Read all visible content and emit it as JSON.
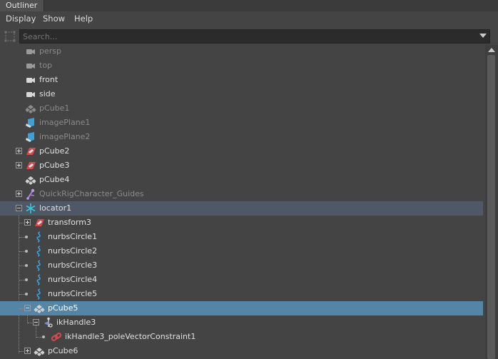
{
  "window": {
    "tab_title": "Outliner"
  },
  "menu": {
    "items": [
      "Display",
      "Show",
      "Help"
    ]
  },
  "search": {
    "placeholder": "Search..."
  },
  "tree": {
    "rows": [
      {
        "label": "persp",
        "icon": "camera-icon",
        "state": "dim"
      },
      {
        "label": "top",
        "icon": "camera-icon",
        "state": "dim"
      },
      {
        "label": "front",
        "icon": "camera-icon",
        "state": "normal"
      },
      {
        "label": "side",
        "icon": "camera-icon",
        "state": "normal"
      },
      {
        "label": "pCube1",
        "icon": "mesh-icon",
        "state": "dim"
      },
      {
        "label": "imagePlane1",
        "icon": "image-plane-icon",
        "state": "dim"
      },
      {
        "label": "imagePlane2",
        "icon": "image-plane-icon",
        "state": "dim"
      },
      {
        "label": "pCube2",
        "icon": "transform-icon",
        "state": "normal",
        "expander": "plus"
      },
      {
        "label": "pCube3",
        "icon": "transform-icon",
        "state": "normal",
        "expander": "plus"
      },
      {
        "label": "pCube4",
        "icon": "mesh-icon",
        "state": "normal"
      },
      {
        "label": "QuickRigCharacter_Guides",
        "icon": "joint-icon",
        "state": "dim",
        "expander": "plus"
      },
      {
        "label": "locator1",
        "icon": "locator-icon",
        "state": "normal",
        "expander": "minus",
        "highlight": true
      },
      {
        "label": "transform3",
        "icon": "transform-icon",
        "state": "normal",
        "expander": "plus"
      },
      {
        "label": "nurbsCircle1",
        "icon": "curve-icon",
        "state": "normal"
      },
      {
        "label": "nurbsCircle2",
        "icon": "curve-icon",
        "state": "normal"
      },
      {
        "label": "nurbsCircle3",
        "icon": "curve-icon",
        "state": "normal"
      },
      {
        "label": "nurbsCircle4",
        "icon": "curve-icon",
        "state": "normal"
      },
      {
        "label": "nurbsCircle5",
        "icon": "curve-icon",
        "state": "normal"
      },
      {
        "label": "pCube5",
        "icon": "mesh-icon",
        "state": "normal",
        "expander": "minus",
        "selected": true
      },
      {
        "label": "ikHandle3",
        "icon": "ik-handle-icon",
        "state": "normal",
        "expander": "minus"
      },
      {
        "label": "ikHandle3_poleVectorConstraint1",
        "icon": "constraint-icon",
        "state": "normal"
      },
      {
        "label": "pCube6",
        "icon": "mesh-icon",
        "state": "normal",
        "expander": "plus"
      }
    ]
  },
  "colors": {
    "background": "#444444",
    "selection": "#5285a6",
    "highlight": "#4e5866",
    "locator_icon": "#35c9d9",
    "curve_icon": "#3aa2d8",
    "transform_icon": "#d8484c",
    "constraint_icon": "#d8484c"
  }
}
